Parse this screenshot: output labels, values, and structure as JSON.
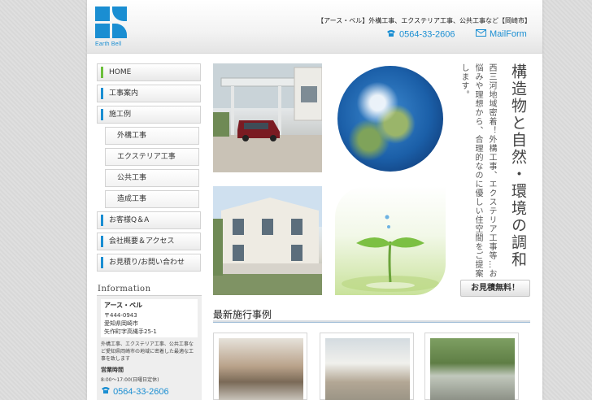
{
  "header": {
    "top_strip": "",
    "logo_text": "Earth Bell",
    "tagline": "【アース・ベル】外構工事、エクステリア工事、公共工事など【岡崎市】",
    "phone": "0564-33-2606",
    "mail_label": "MailForm"
  },
  "nav": {
    "items": [
      {
        "label": "HOME"
      },
      {
        "label": "工事案内"
      },
      {
        "label": "施工例"
      },
      {
        "label": "外構工事"
      },
      {
        "label": "エクステリア工事"
      },
      {
        "label": "公共工事"
      },
      {
        "label": "造成工事"
      },
      {
        "label": "お客様Q＆A"
      },
      {
        "label": "会社概要＆アクセス"
      },
      {
        "label": "お見積り/お問い合わせ"
      }
    ]
  },
  "info": {
    "title": "Information",
    "name": "アース・ベル",
    "postal": "〒444-0943",
    "addr1": "愛知県岡崎市",
    "addr2": "矢作町字高縄手25-1",
    "desc": "外構工事、エクステリア工事、公共工事など愛知県岡崎市の地域に密着した最適な工事を致します",
    "hours_title": "営業時間",
    "hours": "8:00～17:00(日曜日定休)",
    "phone": "0564-33-2606"
  },
  "main": {
    "title_vertical": "構造物と自然・環境の調和",
    "subtitle_vertical": "西三河地域密着！外構工事、エクステリア工事等…お悩みや理想から、合理的なのに優しい住空間をご提案します。",
    "estimate_button": "お見積無料！",
    "recent_title": "最新施行事例"
  },
  "colors": {
    "accent": "#1a8ed2",
    "home_marker": "#6cbf3c"
  }
}
